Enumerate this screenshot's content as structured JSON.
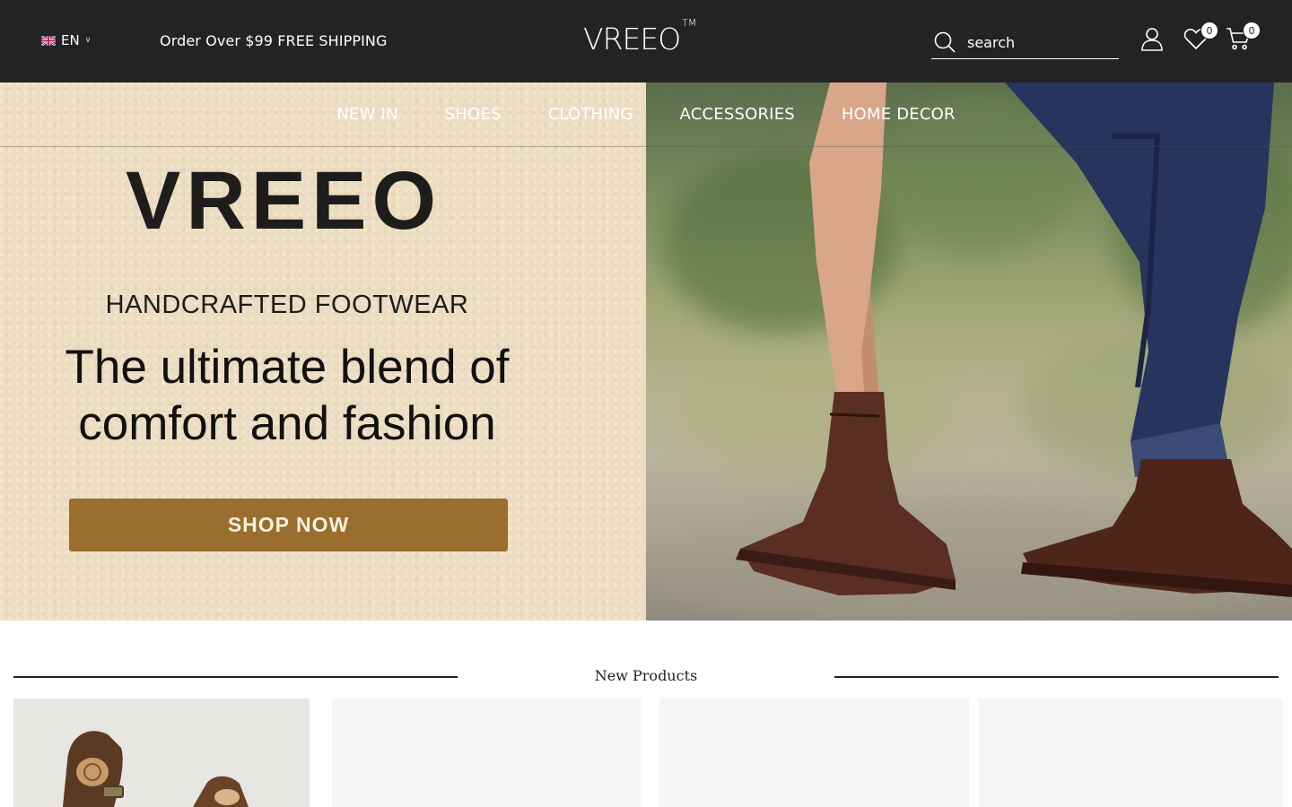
{
  "header": {
    "language": "EN",
    "promo": "Order Over $99 FREE SHIPPING",
    "logo": "VREEO",
    "logo_mark": "TM",
    "search_placeholder": "search",
    "wishlist_count": "0",
    "cart_count": "0"
  },
  "nav": {
    "items": [
      "NEW IN",
      "SHOES",
      "CLOTHING",
      "ACCESSORIES",
      "HOME DECOR"
    ]
  },
  "hero": {
    "brand": "VREEO",
    "tagline": "HANDCRAFTED FOOTWEAR",
    "headline_line1": "The ultimate blend of",
    "headline_line2": "comfort and fashion",
    "cta": "SHOP NOW"
  },
  "products": {
    "section_title": "New Products"
  },
  "colors": {
    "header_bg": "#232323",
    "cta_bg": "#9a6e2e",
    "hero_left_bg": "#ecdcc0"
  }
}
